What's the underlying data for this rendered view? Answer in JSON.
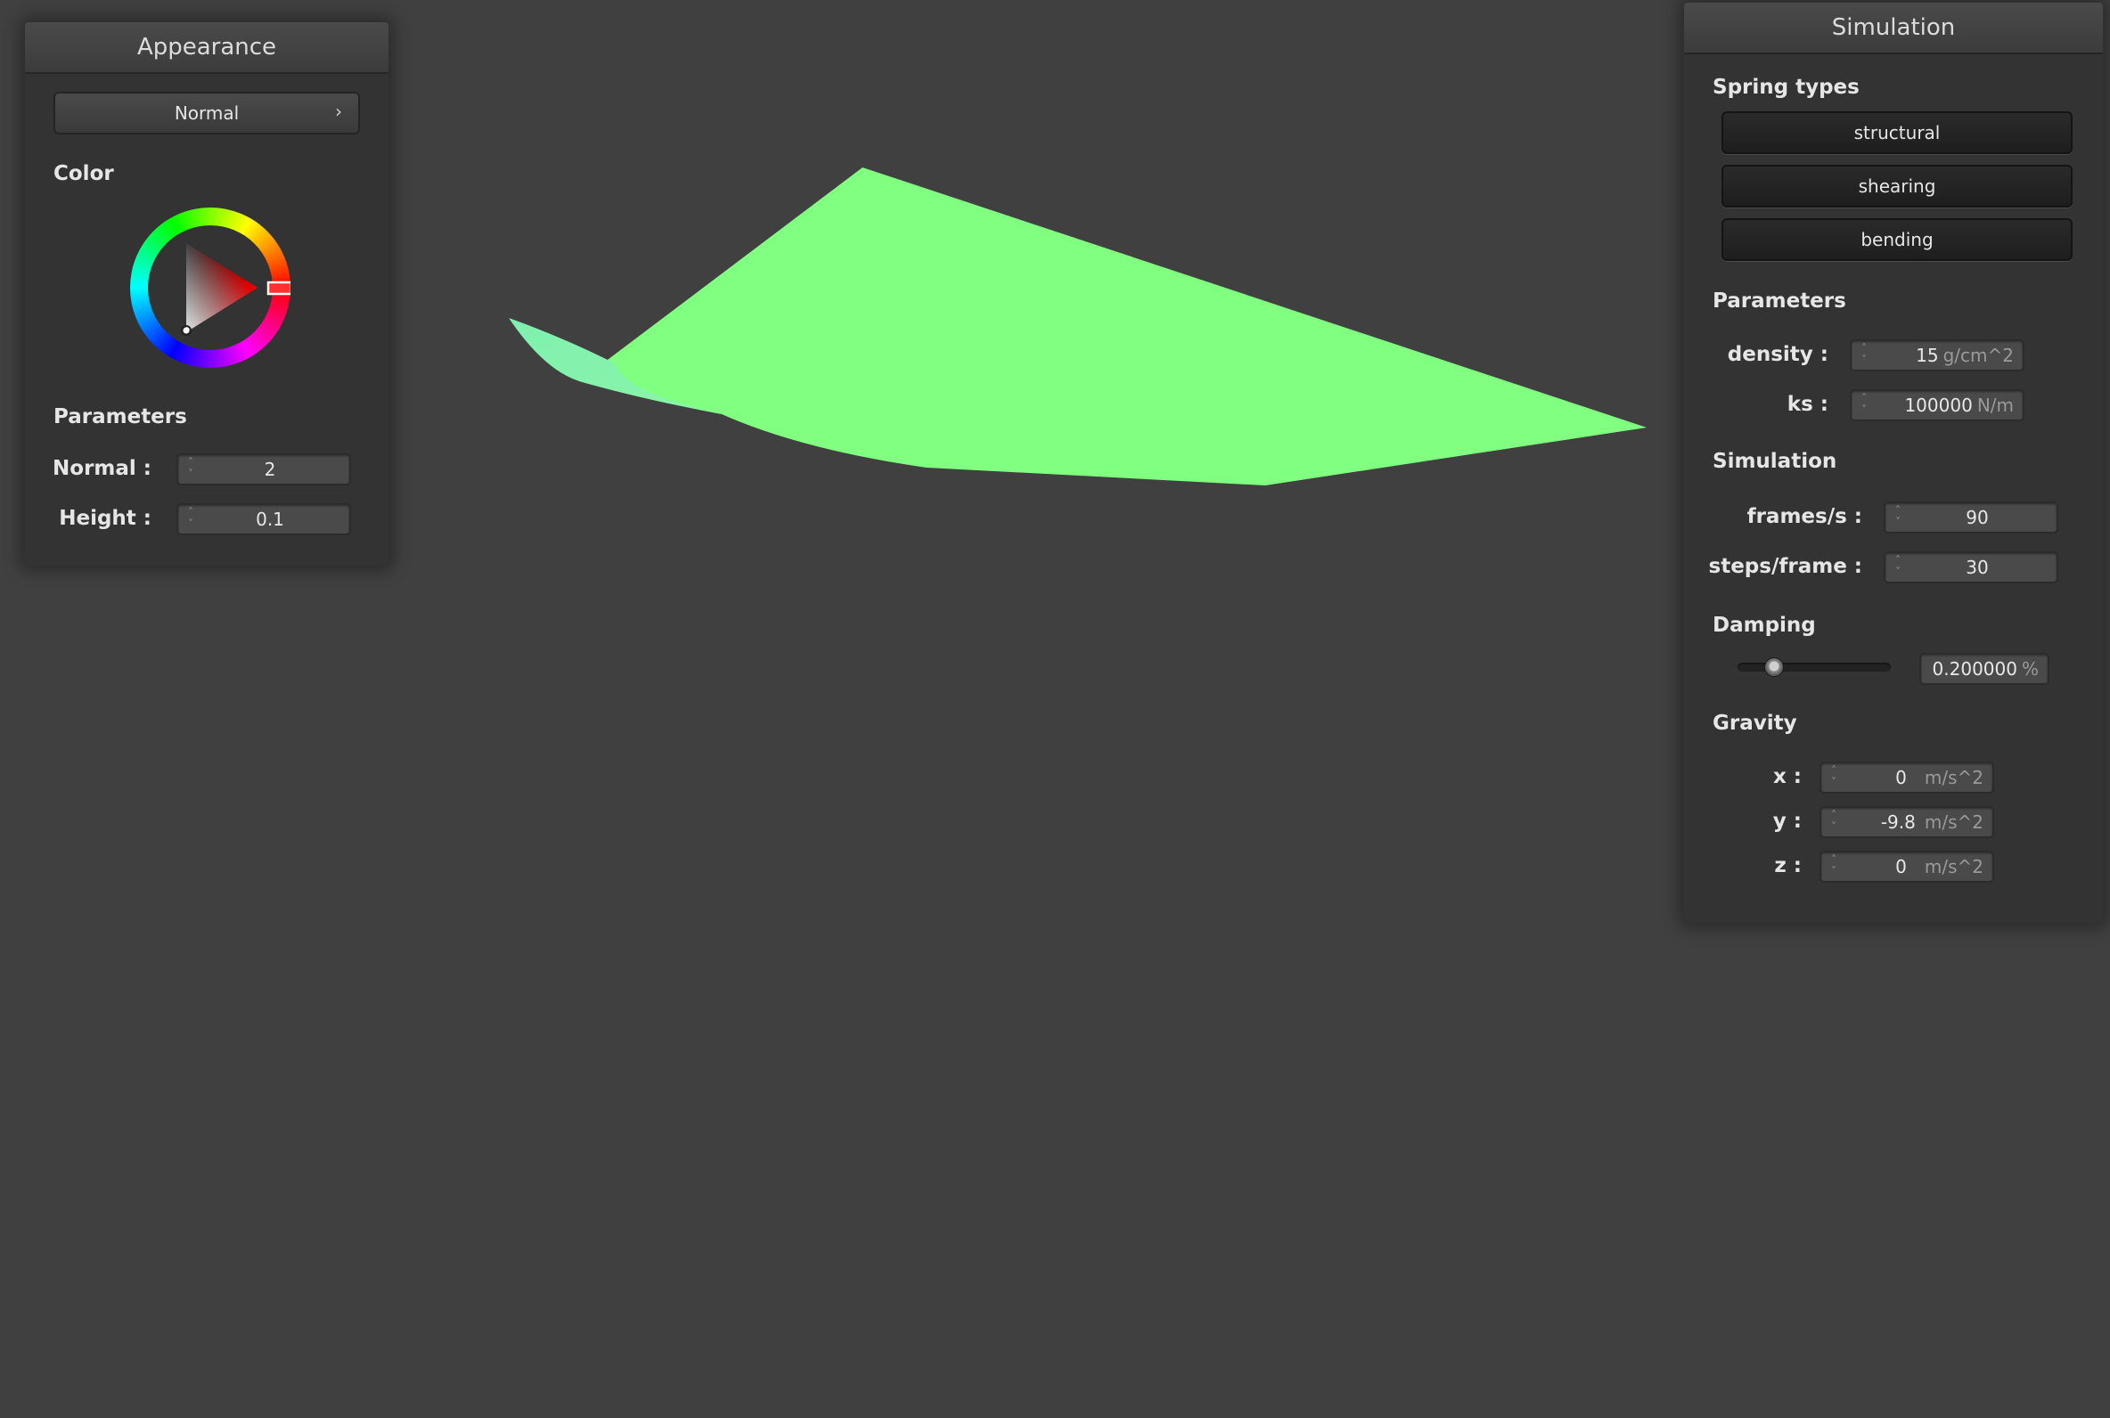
{
  "colors": {
    "background": "#404040",
    "panel": "#333333",
    "cloth": "#80ff80",
    "selected_hue": "#ff0000"
  },
  "appearance": {
    "title": "Appearance",
    "mode_label": "Normal",
    "color_label": "Color",
    "parameters_label": "Parameters",
    "normal_label": "Normal :",
    "normal_value": "2",
    "height_label": "Height :",
    "height_value": "0.1"
  },
  "simulation": {
    "title": "Simulation",
    "spring_types_label": "Spring types",
    "spring_buttons": [
      "structural",
      "shearing",
      "bending"
    ],
    "parameters_label": "Parameters",
    "density_label": "density :",
    "density_value": "15",
    "density_unit": "g/cm^2",
    "ks_label": "ks :",
    "ks_value": "100000",
    "ks_unit": "N/m",
    "simulation_label": "Simulation",
    "fps_label": "frames/s :",
    "fps_value": "90",
    "steps_label": "steps/frame :",
    "steps_value": "30",
    "damping_label": "Damping",
    "damping_value": "0.200000",
    "damping_unit": "%",
    "damping_fraction": 0.2,
    "gravity_label": "Gravity",
    "gx_label": "x :",
    "gx_value": "0",
    "gy_label": "y :",
    "gy_value": "-9.8",
    "gz_label": "z :",
    "gz_value": "0",
    "gravity_unit": "m/s^2"
  }
}
